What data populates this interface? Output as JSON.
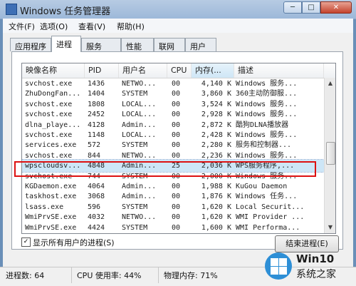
{
  "window": {
    "title": "Windows 任务管理器"
  },
  "caption_buttons": {
    "minimize": "─",
    "maximize": "□",
    "close": "✕"
  },
  "menu": [
    "文件(F)",
    "选项(O)",
    "查看(V)",
    "帮助(H)"
  ],
  "tabs": [
    "应用程序",
    "进程",
    "服务",
    "性能",
    "联网",
    "用户"
  ],
  "active_tab": "进程",
  "columns": [
    "映像名称",
    "PID",
    "用户名",
    "CPU",
    "内存(...",
    "描述"
  ],
  "processes": [
    [
      "svchost.exe",
      "1436",
      "NETWO...",
      "00",
      "4,140 K",
      "Windows 服务..."
    ],
    [
      "ZhuDongFan...",
      "1404",
      "SYSTEM",
      "00",
      "3,860 K",
      "360主动防御服..."
    ],
    [
      "svchost.exe",
      "1808",
      "LOCAL...",
      "00",
      "3,524 K",
      "Windows 服务..."
    ],
    [
      "svchost.exe",
      "2452",
      "LOCAL...",
      "00",
      "2,928 K",
      "Windows 服务..."
    ],
    [
      "dlna_playe...",
      "4128",
      "Admin...",
      "00",
      "2,872 K",
      "酷狗DLNA播放器"
    ],
    [
      "svchost.exe",
      "1148",
      "LOCAL...",
      "00",
      "2,428 K",
      "Windows 服务..."
    ],
    [
      "services.exe",
      "572",
      "SYSTEM",
      "00",
      "2,280 K",
      "服务和控制器..."
    ],
    [
      "svchost.exe",
      "844",
      "NETWO...",
      "00",
      "2,236 K",
      "Windows 服务..."
    ],
    [
      "wpscloudsv...",
      "4848",
      "Admin...",
      "25",
      "2,036 K",
      "WPS服务程序,..."
    ],
    [
      "svchost.exe",
      "744",
      "SYSTEM",
      "00",
      "2,000 K",
      "Windows 服务..."
    ],
    [
      "KGDaemon.exe",
      "4064",
      "Admin...",
      "00",
      "1,988 K",
      "KuGou Daemon"
    ],
    [
      "taskhost.exe",
      "3068",
      "Admin...",
      "00",
      "1,876 K",
      "Windows 任务..."
    ],
    [
      "lsass.exe",
      "596",
      "SYSTEM",
      "00",
      "1,620 K",
      "Local Securit..."
    ],
    [
      "WmiPrvSE.exe",
      "4032",
      "NETWO...",
      "00",
      "1,620 K",
      "WMI Provider ..."
    ],
    [
      "WmiPrvSE.exe",
      "4424",
      "SYSTEM",
      "00",
      "1,600 K",
      "WMI Performa..."
    ]
  ],
  "selected_row": 8,
  "show_all_users": {
    "label": "显示所有用户的进程(S)",
    "checked": true
  },
  "end_process_button": "结束进程(E)",
  "status": {
    "process_count": "进程数: 64",
    "cpu_usage": "CPU 使用率: 44%",
    "memory": "物理内存: 71%"
  },
  "watermark": {
    "line1": "Win10",
    "line2": "系统之家"
  },
  "colors": {
    "highlight": "#dd1111",
    "selection": "#cde6f7",
    "titlebar": "#a9c0de"
  }
}
